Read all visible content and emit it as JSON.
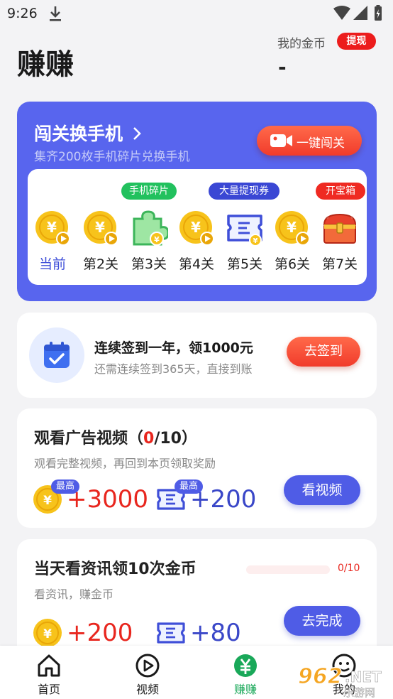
{
  "status": {
    "time": "9:26"
  },
  "header": {
    "title": "赚赚",
    "coins_label": "我的金币",
    "withdraw_label": "提现",
    "coins_value": "-"
  },
  "challenge": {
    "title": "闯关换手机",
    "subtitle": "集齐200枚手机碎片兑换手机",
    "one_key_label": "一键闯关",
    "levels": [
      {
        "name": "当前",
        "icon": "coin-play-icon"
      },
      {
        "name": "第2关",
        "icon": "coin-play-icon"
      },
      {
        "name": "第3关",
        "icon": "puzzle-piece-icon",
        "tag": "手机碎片"
      },
      {
        "name": "第4关",
        "icon": "coin-play-icon"
      },
      {
        "name": "第5关",
        "icon": "voucher-icon",
        "tag": "大量提现券"
      },
      {
        "name": "第6关",
        "icon": "coin-play-icon"
      },
      {
        "name": "第7关",
        "icon": "treasure-chest-icon",
        "tag": "开宝箱"
      }
    ],
    "colors": {
      "accent": "#5865ee",
      "coin": "#f7c31b",
      "green_tag": "#22c15e",
      "red_tag": "#ef2a22"
    }
  },
  "checkin": {
    "title": "连续签到一年，领1000元",
    "subtitle": "还需连续签到365天，直接到账",
    "button_label": "去签到"
  },
  "video_task": {
    "title_prefix": "观看广告视频（",
    "title_count": "0",
    "title_suffix": "/10）",
    "subtitle": "观看完整视频，再回到本页领取奖励",
    "button_label": "看视频",
    "coin_badge": "最高",
    "coin_reward": "+3000",
    "voucher_badge": "最高",
    "voucher_reward": "+200"
  },
  "news_task": {
    "title": "当天看资讯领10次金币",
    "subtitle": "看资讯，赚金币",
    "progress_text": "0/10",
    "progress_fraction": 0,
    "button_label": "去完成",
    "coin_reward": "+200",
    "voucher_reward": "+80"
  },
  "bottom_nav": [
    {
      "label": "首页",
      "icon": "home-icon"
    },
    {
      "label": "视频",
      "icon": "video-play-icon"
    },
    {
      "label": "赚赚",
      "icon": "yuan-coin-icon",
      "active": true
    },
    {
      "label": "我的",
      "icon": "smiley-icon"
    }
  ],
  "watermark": {
    "text": "962.NET",
    "subtext": "乐游网"
  }
}
